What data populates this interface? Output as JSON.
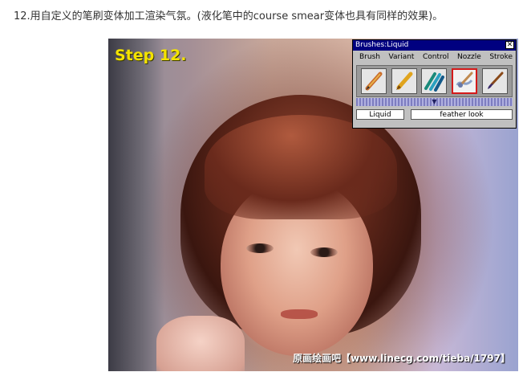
{
  "caption": "12.用自定义的笔刷变体加工渲染气氛。(液化笔中的course smear变体也具有同样的效果)。",
  "painting": {
    "step_label": "Step 12.",
    "watermark": "原画绘画吧【www.linecg.com/tieba/1797】"
  },
  "palette": {
    "title": "Brushes:Liquid",
    "close_label": "✕",
    "menu": [
      "Brush",
      "Variant",
      "Control",
      "Nozzle",
      "Stroke"
    ],
    "brushes": [
      {
        "icon": "pencil-brush-icon",
        "selected": false
      },
      {
        "icon": "felt-pen-brush-icon",
        "selected": false
      },
      {
        "icon": "markers-brush-icon",
        "selected": false
      },
      {
        "icon": "liquid-smear-brush-icon",
        "selected": true
      },
      {
        "icon": "paintbrush-brush-icon",
        "selected": false
      }
    ],
    "selected_color": "#d41a1a",
    "category": "Liquid",
    "variant": "feather look"
  }
}
